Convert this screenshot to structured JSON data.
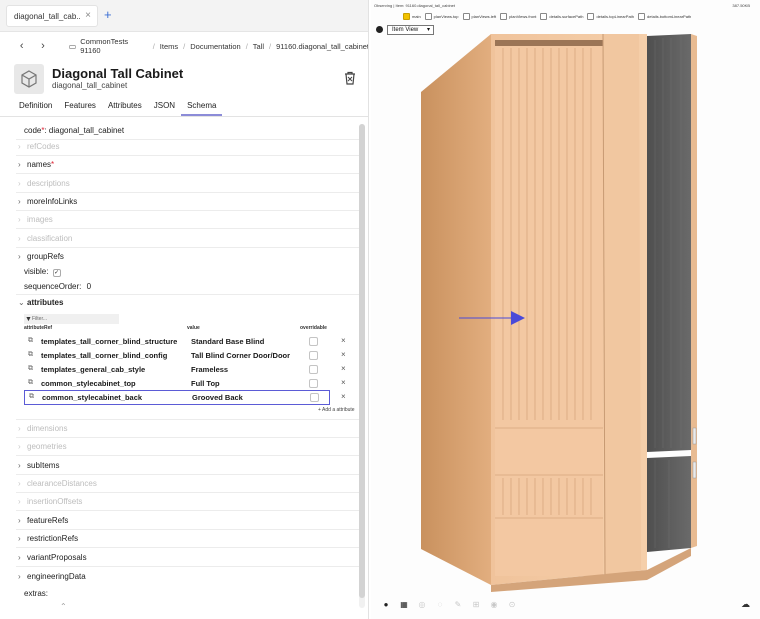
{
  "tab": {
    "title": "diagonal_tall_cab..",
    "close": "×",
    "add": "+"
  },
  "nav": {
    "back": "‹",
    "forward": "›",
    "breadcrumb": [
      "CommonTests 91160",
      "Items",
      "Documentation",
      "Tall",
      "91160.diagonal_tall_cabinet"
    ]
  },
  "item": {
    "title": "Diagonal Tall Cabinet",
    "subtitle": "diagonal_tall_cabinet"
  },
  "subtabs": [
    "Definition",
    "Features",
    "Attributes",
    "JSON",
    "Schema"
  ],
  "schema": {
    "code_label": "code",
    "code_required": "*",
    "code_value": ": diagonal_tall_cabinet",
    "ref_codes": "refCodes",
    "names": "names",
    "names_required": "*",
    "descriptions": "descriptions",
    "more_info_links": "moreInfoLinks",
    "images": "images",
    "classification": "classification",
    "group_refs": "groupRefs",
    "visible_label": "visible:",
    "visible_check": "✓",
    "sequence_order_label": "sequenceOrder:",
    "sequence_order_value": "0",
    "attributes": "attributes",
    "filter_placeholder": "Filter...",
    "col_attribute_ref": "attributeRef",
    "col_value": "value",
    "col_overridable": "overridable",
    "attribute_rows": [
      {
        "ref": "templates_tall_corner_blind_structure",
        "value": "Standard Base Blind"
      },
      {
        "ref": "templates_tall_corner_blind_config",
        "value": "Tall Blind Corner Door/Door"
      },
      {
        "ref": "templates_general_cab_style",
        "value": "Frameless"
      },
      {
        "ref": "common_stylecabinet_top",
        "value": "Full Top"
      },
      {
        "ref": "common_stylecabinet_back",
        "value": "Grooved Back"
      }
    ],
    "delete_symbol": "×",
    "add_attribute": "+ Add a attribute",
    "dimensions": "dimensions",
    "geometries": "geometries",
    "subitems": "subItems",
    "clearance_distances": "clearanceDistances",
    "insertion_offsets": "insertionOffsets",
    "feature_refs": "featureRefs",
    "restriction_refs": "restrictionRefs",
    "variant_proposals": "variantProposals",
    "engineering_data": "engineeringData",
    "extras": "extras:"
  },
  "viewer": {
    "observing": "Observing | Item: 91160.diagonal_tall_cabinet",
    "size": "387.50KB",
    "checkboxes": [
      {
        "label": "main",
        "checked": true
      },
      {
        "label": "planViews.top",
        "checked": false
      },
      {
        "label": "planViews.left",
        "checked": false
      },
      {
        "label": "planViews.front",
        "checked": false
      },
      {
        "label": "details.surfacePath",
        "checked": false
      },
      {
        "label": "details.topLinearPath",
        "checked": false
      },
      {
        "label": "details.bottomLinearPath",
        "checked": false
      }
    ],
    "view_select": "Item View"
  },
  "colors": {
    "accent": "#5b5bd6",
    "wood": "#eab98e",
    "grey_door": "#5a5a5a"
  }
}
